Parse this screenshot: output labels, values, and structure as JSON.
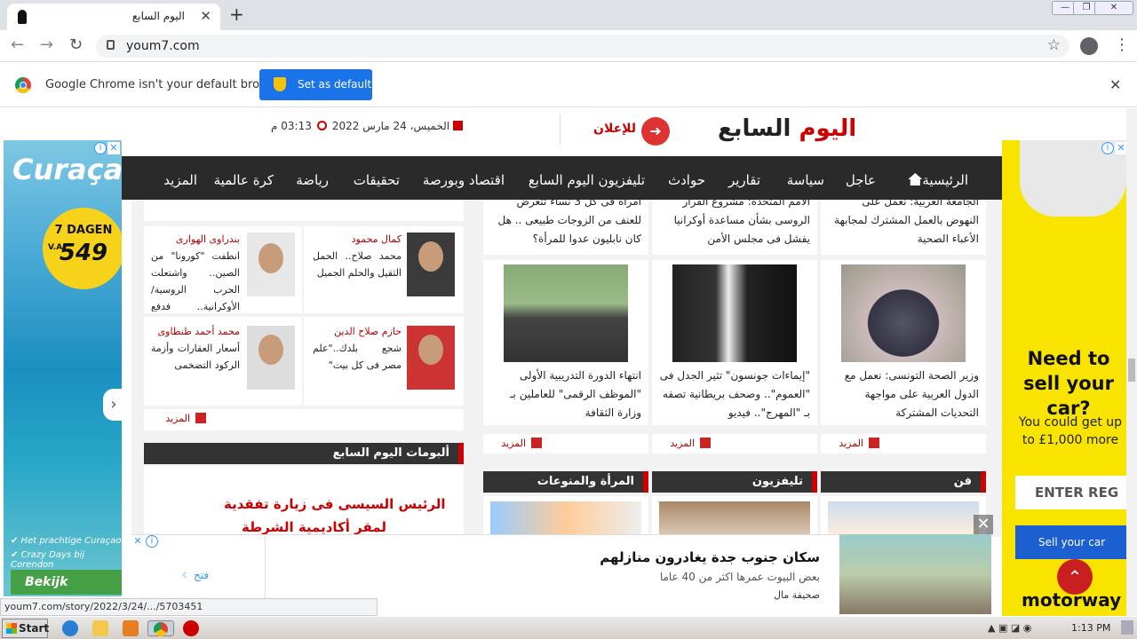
{
  "browser": {
    "tab_title": "اليوم السابع",
    "url": "youm7.com",
    "new_tab": "+",
    "infobar_text": "Google Chrome isn't your default browser",
    "set_default": "Set as default",
    "status_url": "youm7.com/story/2022/3/24/.../5703451"
  },
  "site": {
    "logo_a": "اليوم ",
    "logo_b": "السابع",
    "advertise": "للإعلان",
    "date": "الخميس، 24 مارس 2022",
    "time": "03:13 م"
  },
  "nav": [
    "الرئيسية",
    "عاجل",
    "سياسة",
    "تقارير",
    "حوادث",
    "تليفزيون اليوم السابع",
    "اقتصاد وبورصة",
    "تحقيقات",
    "رياضة",
    "كرة عالمية",
    "المزيد"
  ],
  "columns": [
    {
      "name": "كمال محمود",
      "desc": "محمد صلاح.. الحمل الثقيل والحلم الجميل"
    },
    {
      "name": "بندراوى الهوارى",
      "desc": "انطفت \"كورونا\" من الصين.. واشتعلت الحرب الروسية/ الأوكرانية.. فدفع العالم"
    },
    {
      "name": "حازم صلاح الدين",
      "desc": "شجع بلدك..\"علم مصر فى كل بيت\""
    },
    {
      "name": "محمد أحمد طنطاوى",
      "desc": "أسعار العقارات وأزمة الركود التضخمى"
    }
  ],
  "more": "المزيد",
  "albums": {
    "title": "ألبومات اليوم السابع",
    "caption1": "الرئيس السيسى فى زيارة تفقدية",
    "caption2": "لمقر أكاديمية الشرطة"
  },
  "top_partial": [
    {
      "text": "الجامعة العربية: نعمل على النهوض بالعمل المشترك لمجابهة الأعباء الصحية"
    },
    {
      "text": "الأمم المتحدة: مشروع القرار الروسى بشأن مساعدة أوكرانيا يفشل فى مجلس الأمن"
    },
    {
      "text": "امرأة فى كل 3 نساء تتعرض للعنف من الزوجات طبيعى .. هل كان نابليون عدوا للمرأة؟"
    }
  ],
  "news": [
    {
      "title": "وزير الصحة التونسى: نعمل مع الدول العربية على مواجهة التحديات المشتركة"
    },
    {
      "title": "\"إيماءات جونسون\" تثير الجدل فى \"العموم\".. وصحف بريطانية تصفه بـ \"المهرج\".. فيديو"
    },
    {
      "title": "انتهاء الدورة التدريبية الأولى \"الموظف الرقمى\" للعاملين بـ وزارة الثقافة"
    }
  ],
  "sections": [
    "فن",
    "تليفزيون",
    "المرأة والمنوعات"
  ],
  "left_ad": {
    "title": "Curaçao",
    "badge_top": "7 DAGEN",
    "badge_price": "549",
    "badge_va": "V.A.",
    "bullet1": "✔ Het prachtige Curaçao",
    "bullet2": "✔ Crazy Days bij Corendon",
    "button": "Bekijk aanbod"
  },
  "right_ad": {
    "headline": "Need to sell your car?",
    "sub": "You could get up to £1,000 more",
    "input": "ENTER REG",
    "button": "Sell your car",
    "logo": "motorway"
  },
  "bottom_ad": {
    "title": "سكان جنوب جدة يغادرون منازلهم",
    "sub": "بعض البيوت عمرها اكثر من 40 عاما",
    "source": "صحيفة مال",
    "open": "فتح"
  },
  "taskbar": {
    "start": "Start",
    "time": "1:13 PM"
  },
  "colors": {
    "accent": "#c00000",
    "navbar": "#2a2a2a",
    "chrome_button": "#1a73e8"
  }
}
